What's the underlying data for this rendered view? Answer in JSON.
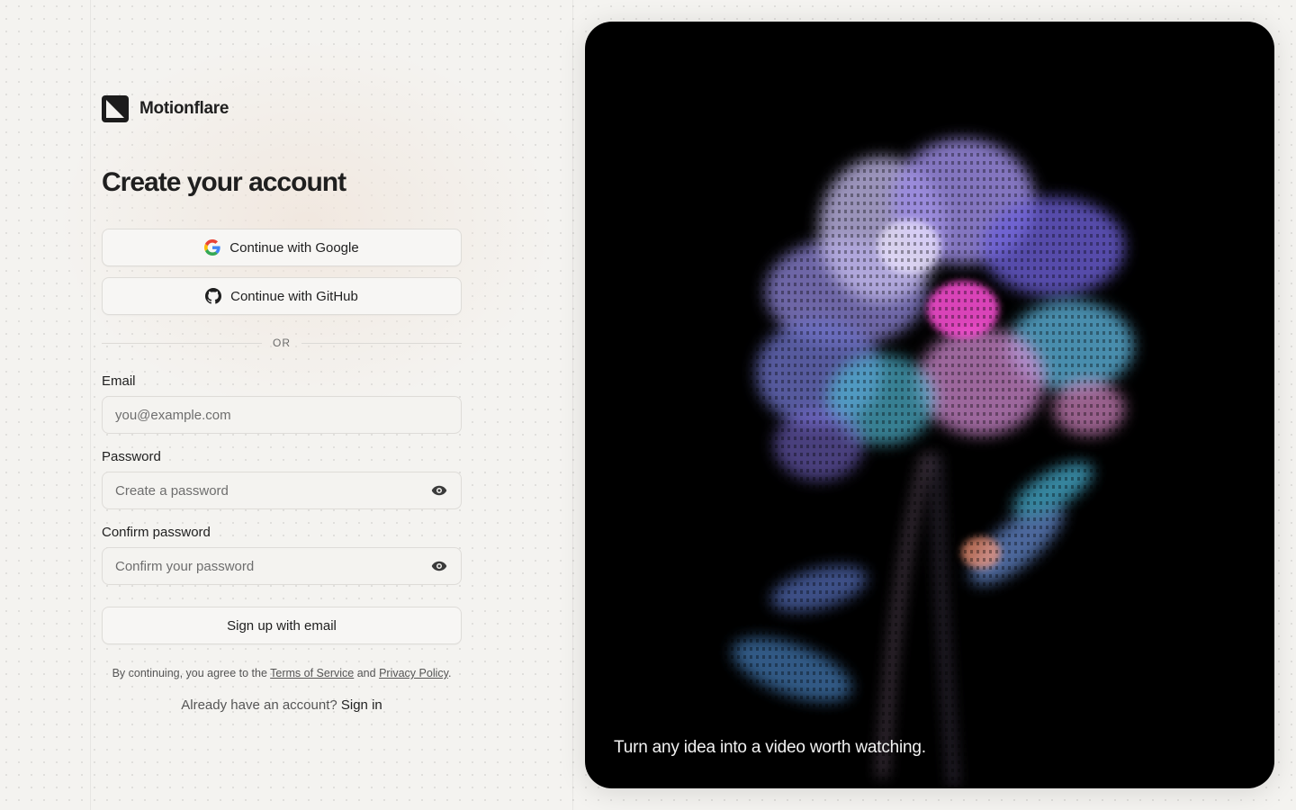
{
  "brand": {
    "name": "Motionflare"
  },
  "heading": "Create your account",
  "oauth": {
    "google_label": "Continue with Google",
    "github_label": "Continue with GitHub"
  },
  "divider_text": "OR",
  "form": {
    "email": {
      "label": "Email",
      "placeholder": "you@example.com",
      "value": ""
    },
    "password": {
      "label": "Password",
      "placeholder": "Create a password",
      "value": ""
    },
    "confirm": {
      "label": "Confirm password",
      "placeholder": "Confirm your password",
      "value": ""
    },
    "submit_label": "Sign up with email"
  },
  "legal": {
    "prefix": "By continuing, you agree to the",
    "terms_link": "Terms of Service",
    "conjunction": "and",
    "privacy_link": "Privacy Policy",
    "suffix": "."
  },
  "signin": {
    "prompt": "Already have an account?",
    "link": "Sign in"
  },
  "hero": {
    "caption": "Turn any idea into a video worth watching."
  },
  "icons": {
    "google": "google-icon",
    "github": "github-icon",
    "eye": "eye-icon",
    "logo": "motionflare-logo-icon"
  },
  "colors": {
    "background": "#f4f3f0",
    "hero_background": "#000000",
    "text": "#1f1f1f",
    "border": "#dedcd8"
  }
}
